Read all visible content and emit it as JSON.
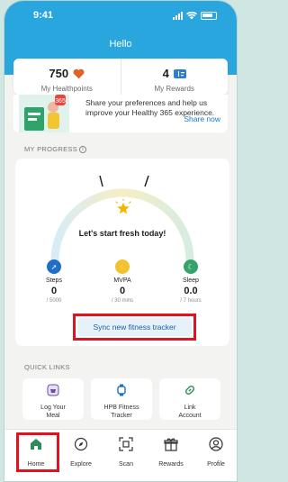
{
  "status": {
    "time": "9:41"
  },
  "header": {
    "title": "Hello"
  },
  "stats": [
    {
      "value": "750",
      "label": "My Healthpoints",
      "icon": "heart-icon"
    },
    {
      "value": "4",
      "label": "My Rewards",
      "icon": "ticket-icon"
    }
  ],
  "banner": {
    "text": "Share your preferences and help us improve your Healthy 365 experience.",
    "link": "Share now"
  },
  "progress": {
    "section_label": "MY PROGRESS",
    "headline": "Let's start fresh today!",
    "metrics": [
      {
        "label": "Steps",
        "value": "0",
        "goal": "/ 5000",
        "color": "#1e6fc5",
        "icon": "steps-icon"
      },
      {
        "label": "MVPA",
        "value": "0",
        "goal": "/ 30 mins",
        "color": "#f1c231",
        "icon": "lightning-icon"
      },
      {
        "label": "Sleep",
        "value": "0.0",
        "goal": "/ 7 hours",
        "color": "#36a36b",
        "icon": "moon-icon"
      }
    ],
    "sync_label": "Sync new fitness tracker"
  },
  "quick_links": {
    "section_label": "QUICK LINKS",
    "items": [
      {
        "label_1": "Log Your",
        "label_2": "Meal",
        "icon": "meal-icon"
      },
      {
        "label_1": "HPB Fitness",
        "label_2": "Tracker",
        "icon": "watch-icon"
      },
      {
        "label_1": "Link",
        "label_2": "Account",
        "icon": "link-icon"
      }
    ]
  },
  "tabs": [
    {
      "label": "Home",
      "icon": "home-icon",
      "active": true
    },
    {
      "label": "Explore",
      "icon": "compass-icon"
    },
    {
      "label": "Scan",
      "icon": "scan-icon"
    },
    {
      "label": "Rewards",
      "icon": "gift-icon"
    },
    {
      "label": "Profile",
      "icon": "profile-icon"
    }
  ],
  "colors": {
    "primary": "#2aa6de",
    "highlight": "#e0121f",
    "active_tab": "#2e8b57"
  }
}
